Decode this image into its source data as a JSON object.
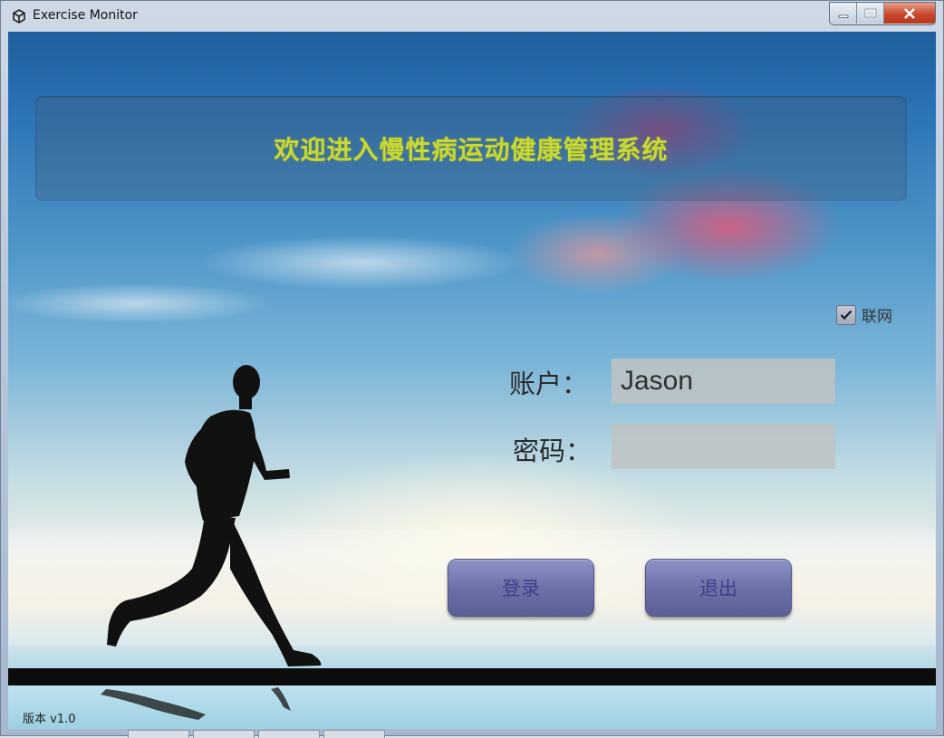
{
  "window": {
    "title": "Exercise Monitor",
    "icon": "unity-icon"
  },
  "banner": {
    "title": "欢迎进入慢性病运动健康管理系统"
  },
  "network": {
    "label": "联网",
    "checked": true
  },
  "login": {
    "account_label": "账户：",
    "account_value": "Jason",
    "password_label": "密码：",
    "password_value": "",
    "login_button": "登录",
    "exit_button": "退出"
  },
  "footer": {
    "version": "版本 v1.0"
  },
  "colors": {
    "title_text": "#c8d83a",
    "button_fill": "#6c71a8",
    "button_text": "#3d3f88"
  }
}
